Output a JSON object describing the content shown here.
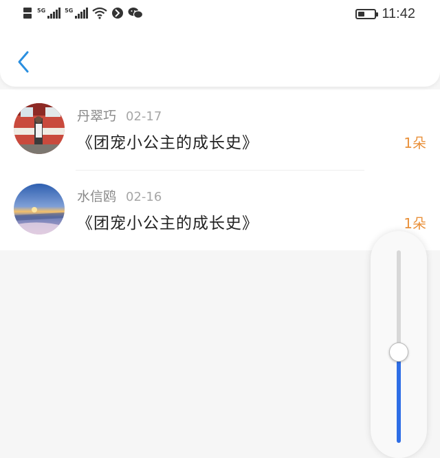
{
  "status_bar": {
    "left_icons": [
      "hd-icon",
      "signal-5g-icon",
      "signal-5g-icon",
      "wifi-icon",
      "vpn-icon",
      "wechat-icon"
    ],
    "signal_label": "5G",
    "battery_level": 0.4,
    "time": "11:42"
  },
  "header": {
    "back_icon": "chevron-left-icon",
    "accent_color": "#2a8fe0"
  },
  "gifts": [
    {
      "user": "丹翠巧",
      "date": "02-17",
      "title": "《团宠小公主的成长史》",
      "count": "1朵"
    },
    {
      "user": "水信鸥",
      "date": "02-16",
      "title": "《团宠小公主的成长史》",
      "count": "1朵"
    }
  ],
  "colors": {
    "count": "#e9903a",
    "slider": "#2e6ee6"
  },
  "brightness_slider": {
    "level": 0.47
  }
}
